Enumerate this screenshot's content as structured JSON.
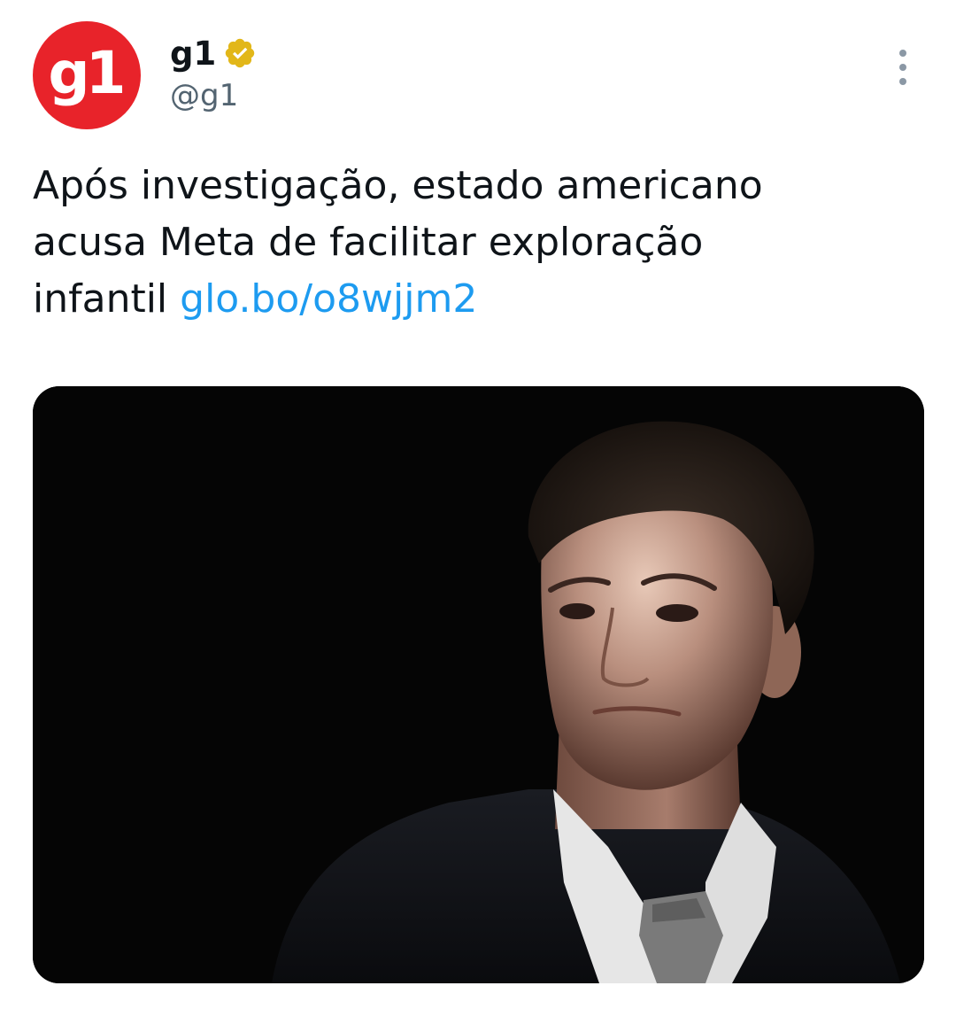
{
  "author": {
    "avatar_text": "g1",
    "name": "g1",
    "handle": "@g1",
    "verified_icon": "verified-gold-badge-icon"
  },
  "menu_icon": "more-vertical-icon",
  "tweet": {
    "text_line1": "Após investigação, estado americano",
    "text_line2": "acusa Meta de facilitar exploração",
    "text_line3": "infantil ",
    "link": "glo.bo/o8wjjm2"
  },
  "media": {
    "kind": "photo"
  },
  "colors": {
    "brand_red": "#e8232a",
    "link_blue": "#1d9bf0",
    "verified_gold": "#e2b719",
    "secondary_text": "#536471"
  }
}
